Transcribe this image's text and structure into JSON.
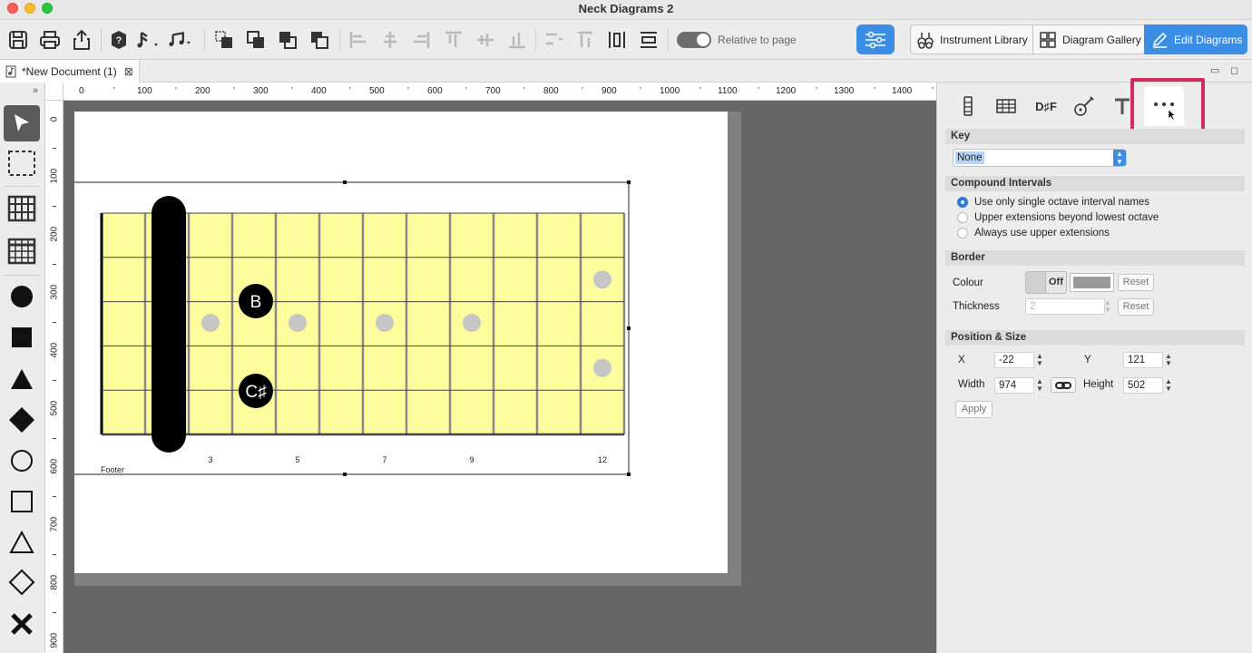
{
  "window": {
    "title": "Neck Diagrams 2"
  },
  "toolbar": {
    "relative_label": "Relative to page",
    "instrument_library": "Instrument Library",
    "diagram_gallery": "Diagram Gallery",
    "edit_diagrams": "Edit Diagrams"
  },
  "document_tab": {
    "name": "*New Document (1)"
  },
  "ruler": {
    "top": [
      "0",
      "100",
      "200",
      "300",
      "400",
      "500",
      "600",
      "700",
      "800",
      "900",
      "1000",
      "1100",
      "1200",
      "1300",
      "1400"
    ],
    "left": [
      "0",
      "100",
      "200",
      "300",
      "400",
      "500",
      "600",
      "700",
      "800",
      "900"
    ]
  },
  "diagram": {
    "notes": [
      {
        "label": "B",
        "string": 3,
        "fret": 4
      },
      {
        "label": "C♯",
        "string": 5,
        "fret": 4
      }
    ],
    "barre": {
      "fret": 2,
      "from_string": 1,
      "to_string": 6
    },
    "fret_numbers": [
      "3",
      "5",
      "7",
      "9",
      "12"
    ],
    "footer": "Footer"
  },
  "inspector": {
    "tabs": [
      "strings-icon",
      "grid-icon",
      "D♯F",
      "guitar-icon",
      "text-icon",
      "more-icon"
    ],
    "key_head": "Key",
    "key_value": "None",
    "compound_head": "Compound Intervals",
    "compound_options": [
      "Use only single octave interval names",
      "Upper extensions beyond lowest octave",
      "Always use upper extensions"
    ],
    "border_head": "Border",
    "colour_label": "Colour",
    "colour_toggle": "Off",
    "border_reset": "Reset",
    "thickness_label": "Thickness",
    "thickness_value": "2",
    "thickness_reset": "Reset",
    "position_head": "Position & Size",
    "x_label": "X",
    "x_value": "-22",
    "y_label": "Y",
    "y_value": "121",
    "width_label": "Width",
    "width_value": "974",
    "height_label": "Height",
    "height_value": "502",
    "apply": "Apply"
  },
  "colors": {
    "fretboard": "#fdfd9e",
    "accent": "#3a8ee6",
    "highlight": "#d22d5c"
  }
}
